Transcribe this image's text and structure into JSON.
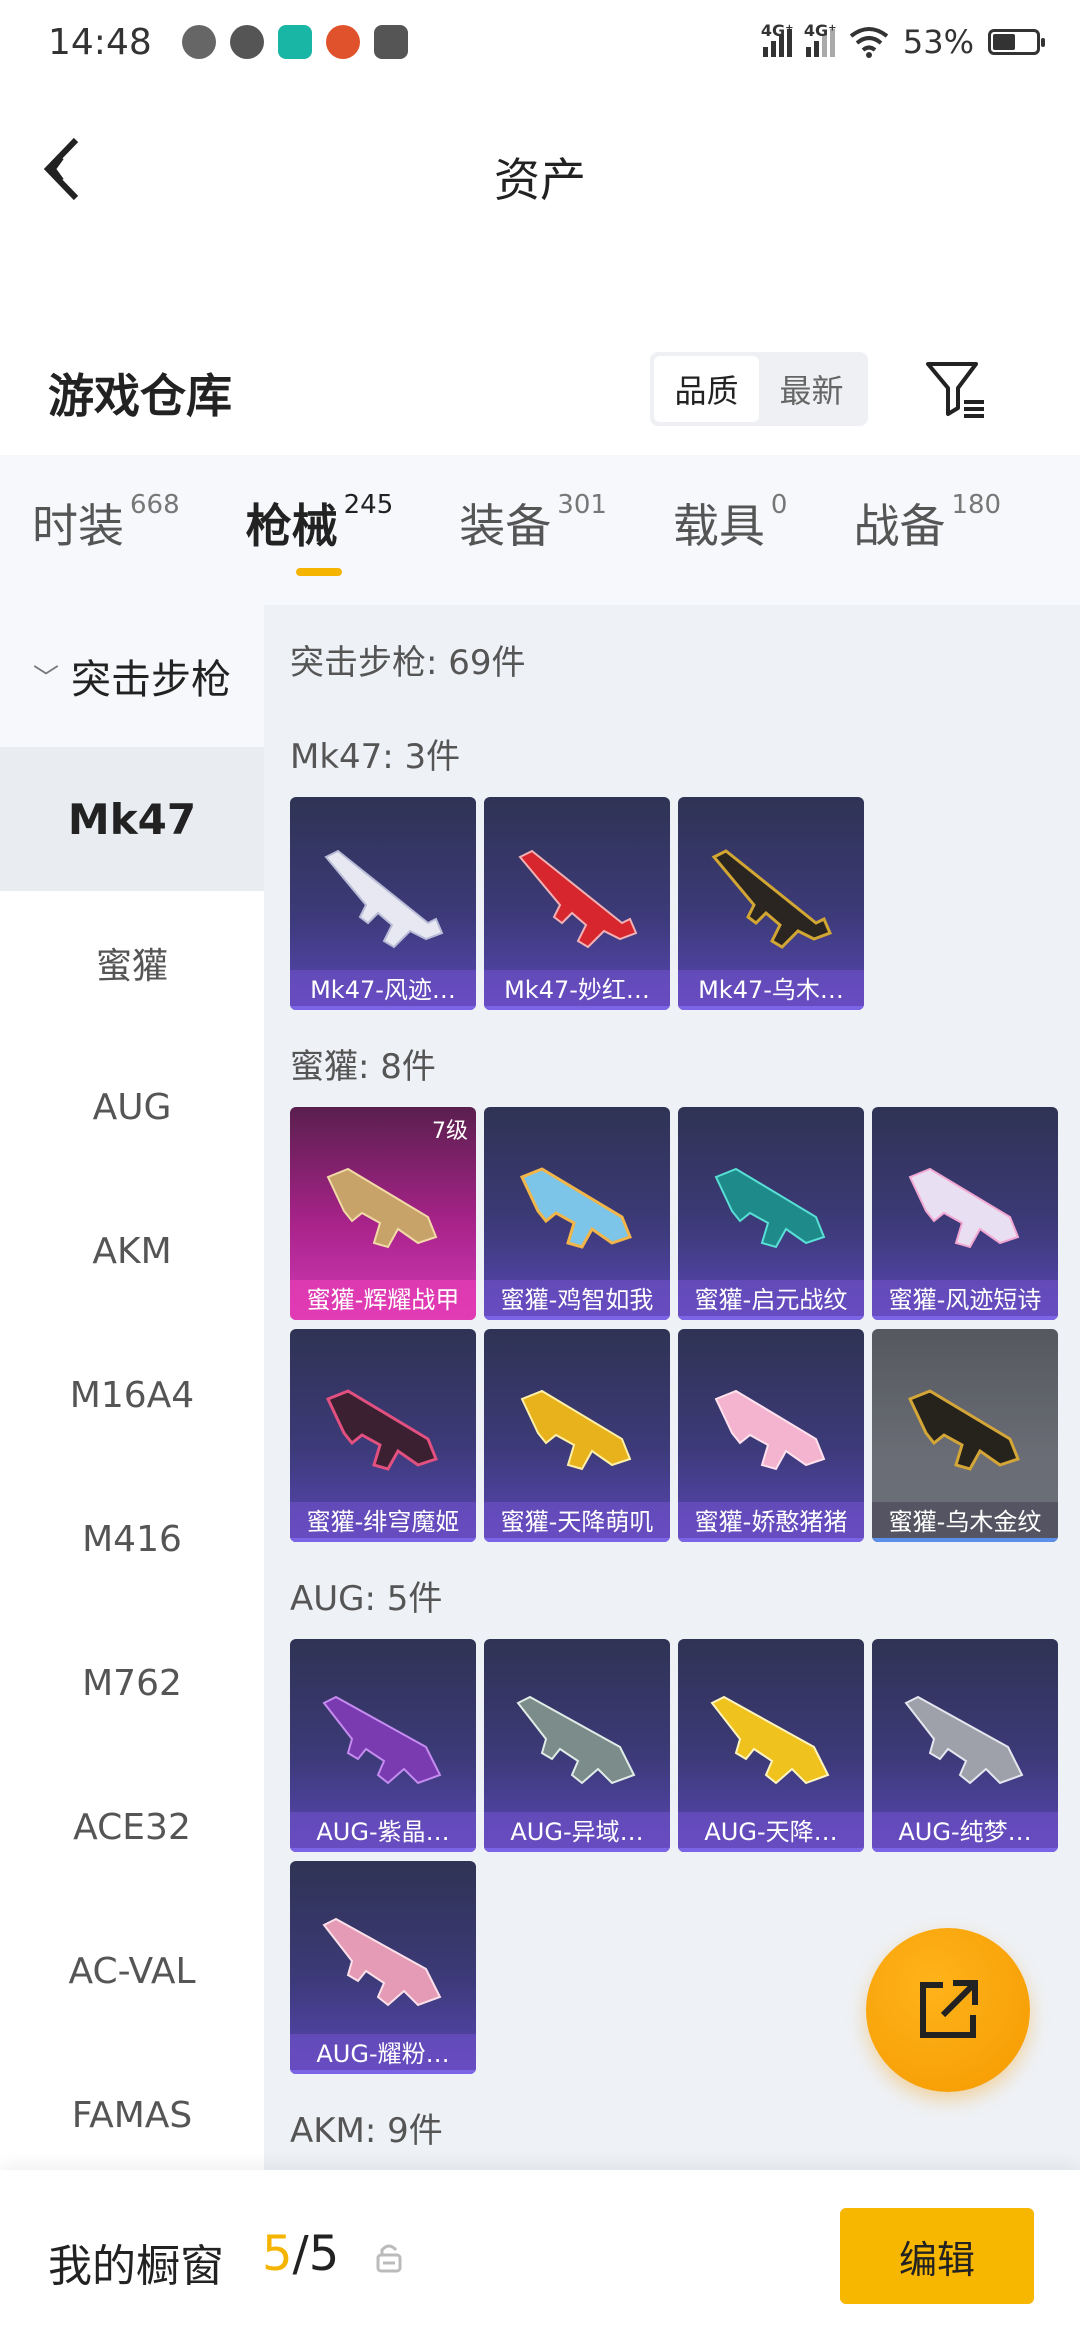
{
  "status_bar": {
    "time": "14:48",
    "network_1": "4G⁺",
    "network_2": "4G⁺",
    "battery": "53%",
    "battery_level": 0.53
  },
  "header": {
    "title": "资产"
  },
  "warehouse": {
    "title": "游戏仓库",
    "sort_options": [
      "品质",
      "最新"
    ],
    "sort_selected": "品质"
  },
  "tabs": [
    {
      "label": "时装",
      "count": "668"
    },
    {
      "label": "枪械",
      "count": "245",
      "active": true
    },
    {
      "label": "装备",
      "count": "301"
    },
    {
      "label": "载具",
      "count": "0"
    },
    {
      "label": "战备",
      "count": "180"
    }
  ],
  "left_nav": {
    "group": "突击步枪",
    "items": [
      "Mk47",
      "蜜獾",
      "AUG",
      "AKM",
      "M16A4",
      "M416",
      "M762",
      "ACE32",
      "AC-VAL",
      "FAMAS"
    ],
    "active": "Mk47"
  },
  "content": {
    "total_header": "突击步枪: 69件",
    "sections": [
      {
        "header": "Mk47: 3件",
        "items": [
          {
            "name": "Mk47-风迹…",
            "style": "normal"
          },
          {
            "name": "Mk47-妙红…",
            "style": "normal"
          },
          {
            "name": "Mk47-乌木…",
            "style": "normal"
          }
        ]
      },
      {
        "header": "蜜獾: 8件",
        "items": [
          {
            "name": "蜜獾-辉耀战甲",
            "style": "pink",
            "level": "7级"
          },
          {
            "name": "蜜獾-鸡智如我",
            "style": "normal"
          },
          {
            "name": "蜜獾-启元战纹",
            "style": "normal"
          },
          {
            "name": "蜜獾-风迹短诗",
            "style": "normal"
          },
          {
            "name": "蜜獾-绯穹魔姬",
            "style": "normal"
          },
          {
            "name": "蜜獾-天降萌叽",
            "style": "normal"
          },
          {
            "name": "蜜獾-娇憨猪猪",
            "style": "normal"
          },
          {
            "name": "蜜獾-乌木金纹",
            "style": "gray"
          }
        ]
      },
      {
        "header": "AUG: 5件",
        "items": [
          {
            "name": "AUG-紫晶…",
            "style": "normal"
          },
          {
            "name": "AUG-异域…",
            "style": "normal"
          },
          {
            "name": "AUG-天降…",
            "style": "normal"
          },
          {
            "name": "AUG-纯梦…",
            "style": "normal"
          },
          {
            "name": "AUG-耀粉…",
            "style": "normal"
          }
        ]
      },
      {
        "header": "AKM: 9件",
        "items": []
      }
    ]
  },
  "bottom_bar": {
    "label": "我的橱窗",
    "current": "5",
    "total": "/5",
    "edit_label": "编辑"
  },
  "colors": {
    "accent": "#f5b400",
    "card_normal": "#3c3a78",
    "card_pink": "#a8238a",
    "card_gray": "#6a6d75"
  }
}
